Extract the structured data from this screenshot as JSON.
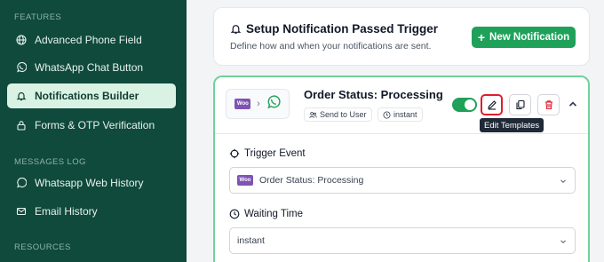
{
  "sidebar": {
    "sections": [
      {
        "label": "FEATURES"
      },
      {
        "label": "MESSAGES LOG"
      },
      {
        "label": "RESOURCES"
      }
    ],
    "items": [
      {
        "label": "Advanced Phone Field",
        "icon": "globe-icon"
      },
      {
        "label": "WhatsApp Chat Button",
        "icon": "whatsapp-icon"
      },
      {
        "label": "Notifications Builder",
        "icon": "bell-icon",
        "active": true
      },
      {
        "label": "Forms & OTP Verification",
        "icon": "lock-icon"
      },
      {
        "label": "Whatsapp Web History",
        "icon": "history-icon"
      },
      {
        "label": "Email History",
        "icon": "mail-icon"
      }
    ]
  },
  "header": {
    "title": "Setup Notification Passed Trigger",
    "subtitle": "Define how and when your notifications are sent.",
    "new_button_label": "New Notification"
  },
  "notification": {
    "flow_source_badge": "Woo",
    "title": "Order Status: Processing",
    "chips": {
      "recipient": "Send to User",
      "timing": "instant"
    },
    "enabled": true,
    "tooltip": "Edit Templates",
    "trigger_label": "Trigger Event",
    "trigger_value": "Order Status: Processing",
    "waiting_label": "Waiting Time",
    "waiting_value": "instant"
  },
  "colors": {
    "sidebar_bg": "#0f4a3c",
    "accent": "#1fa15a",
    "highlight": "#e11d2a"
  }
}
